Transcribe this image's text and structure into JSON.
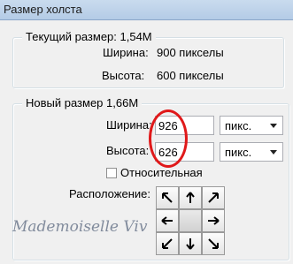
{
  "window": {
    "title": "Размер холста"
  },
  "current": {
    "legend": "Текущий размер: 1,54M",
    "width_label": "Ширина:",
    "width_value": "900 пикселы",
    "height_label": "Высота:",
    "height_value": "600 пикселы"
  },
  "new": {
    "legend": "Новый размер 1,66M",
    "width_label": "Ширина:",
    "width_value": "926",
    "width_unit": "пикс.",
    "height_label": "Высота:",
    "height_value": "626",
    "height_unit": "пикс.",
    "relative_label": "Относительная",
    "relative_checked": false,
    "anchor_label": "Расположение:"
  },
  "anchor_arrows": [
    "arrow-up-left-icon",
    "arrow-up-icon",
    "arrow-up-right-icon",
    "arrow-left-icon",
    "anchor-center",
    "arrow-right-icon",
    "arrow-down-left-icon",
    "arrow-down-icon",
    "arrow-down-right-icon"
  ],
  "watermark": "Mademoiselle Viv",
  "colors": {
    "highlight_circle": "#e0191a",
    "titlebar": "#c9dbee"
  }
}
